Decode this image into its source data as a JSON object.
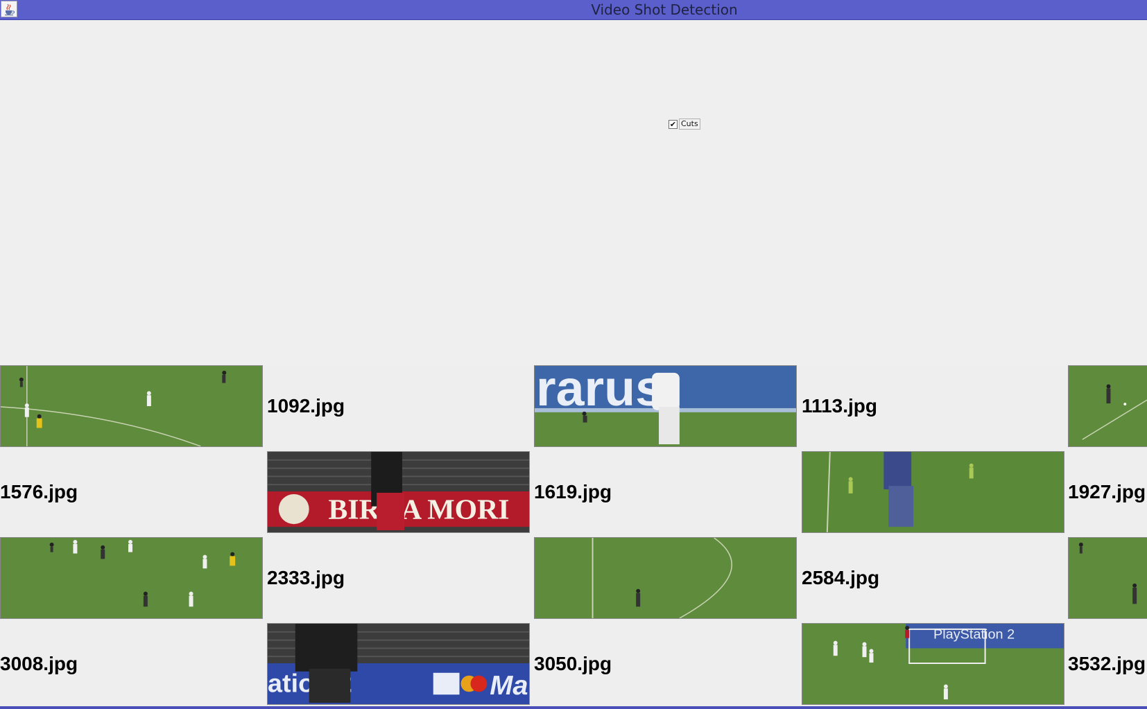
{
  "window": {
    "title": "Video Shot Detection",
    "icon": "java-cup-icon"
  },
  "controls": {
    "cuts_label": "Cuts",
    "cuts_checked": true,
    "check_glyph": "✔"
  },
  "results": {
    "row1": [
      "1092.jpg",
      "1113.jpg"
    ],
    "row2": [
      "1576.jpg",
      "1619.jpg",
      "1927.jpg"
    ],
    "row3": [
      "2333.jpg",
      "2584.jpg"
    ],
    "row4": [
      "3008.jpg",
      "3050.jpg",
      "3532.jpg"
    ]
  },
  "colors": {
    "titlebar": "#5b5fcb",
    "pitch": "#5d8a3a",
    "panel": "#eeeeee"
  }
}
